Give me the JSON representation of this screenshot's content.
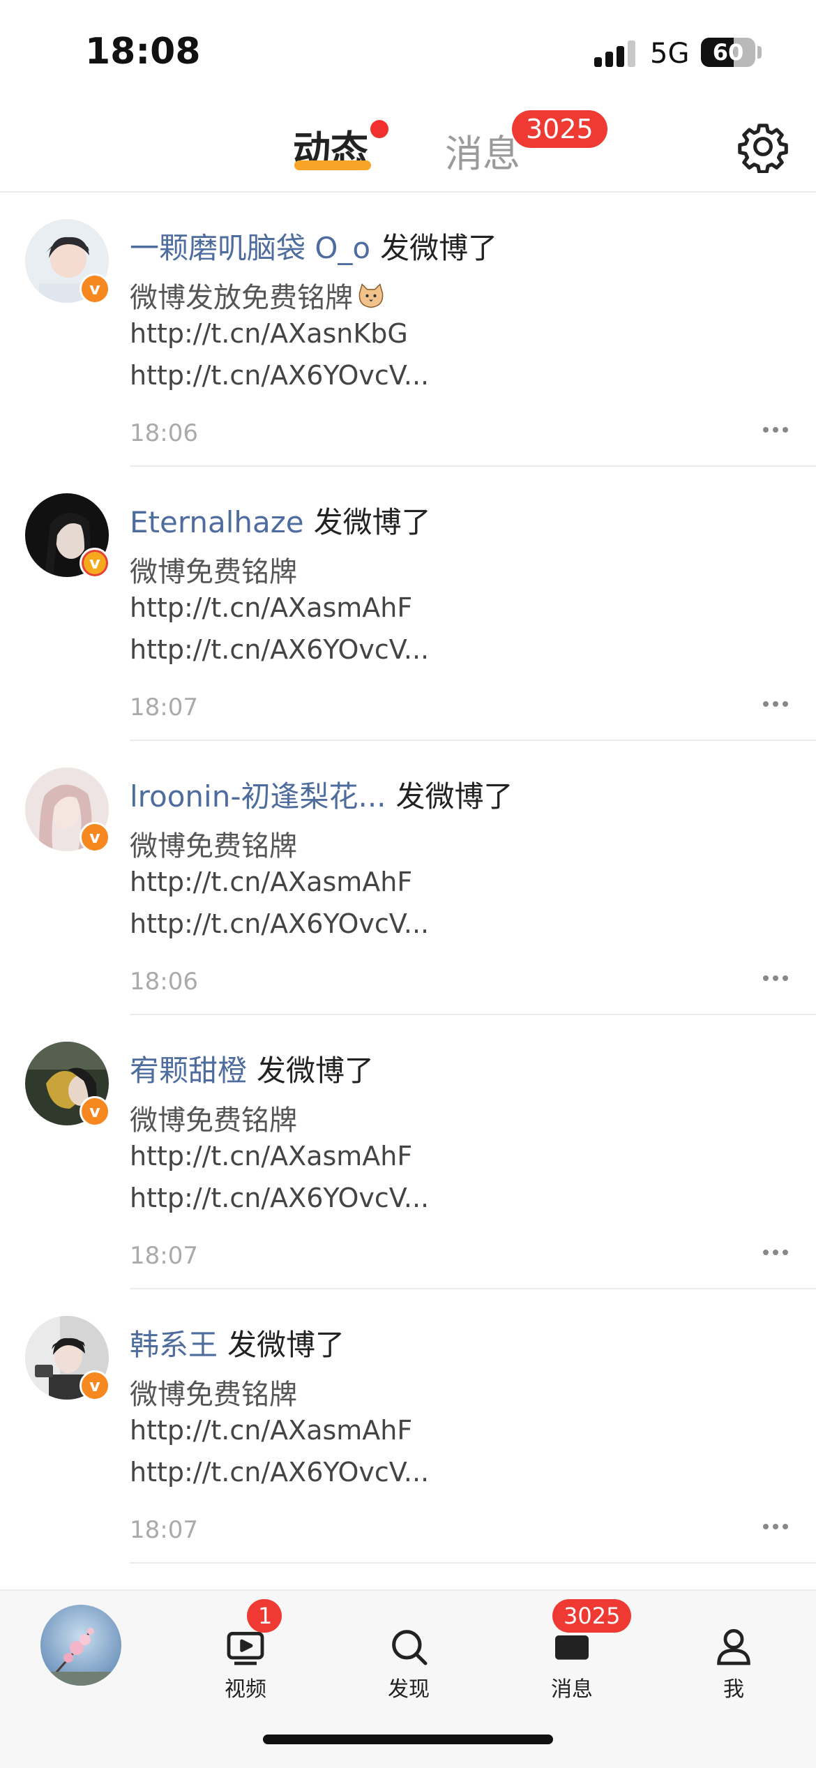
{
  "status_bar": {
    "time": "18:08",
    "network": "5G",
    "battery": "60"
  },
  "header": {
    "tab_active": "动态",
    "tab_inactive": "消息",
    "badge": "3025"
  },
  "feed": [
    {
      "name": "一颗磨叽脑袋 O_o",
      "action": "发微博了",
      "text": "微博发放免费铭牌",
      "has_emoji": true,
      "link1": "http://t.cn/AXasnKbG",
      "link2": "http://t.cn/AX6YOvcV...",
      "time": "18:06"
    },
    {
      "name": "Eternalhaze",
      "action": "发微博了",
      "text": "微博免费铭牌",
      "link1": "http://t.cn/AXasmAhF",
      "link2": "http://t.cn/AX6YOvcV...",
      "time": "18:07"
    },
    {
      "name": "lroonin-初逢梨花...",
      "action": "发微博了",
      "text": "微博免费铭牌",
      "link1": "http://t.cn/AXasmAhF",
      "link2": "http://t.cn/AX6YOvcV...",
      "time": "18:06"
    },
    {
      "name": "宥颗甜橙",
      "action": "发微博了",
      "text": "微博免费铭牌",
      "link1": "http://t.cn/AXasmAhF",
      "link2": "http://t.cn/AX6YOvcV...",
      "time": "18:07"
    },
    {
      "name": "韩系王",
      "action": "发微博了",
      "text": "微博免费铭牌",
      "link1": "http://t.cn/AXasmAhF",
      "link2": "http://t.cn/AX6YOvcV...",
      "time": "18:07"
    }
  ],
  "tabbar": {
    "video": {
      "label": "视频",
      "badge": "1"
    },
    "discover": {
      "label": "发现"
    },
    "messages": {
      "label": "消息",
      "badge": "3025"
    },
    "me": {
      "label": "我"
    }
  },
  "colors": {
    "accent": "#f7a428",
    "badge_red": "#ee3a33",
    "username": "#4e6c9d"
  }
}
